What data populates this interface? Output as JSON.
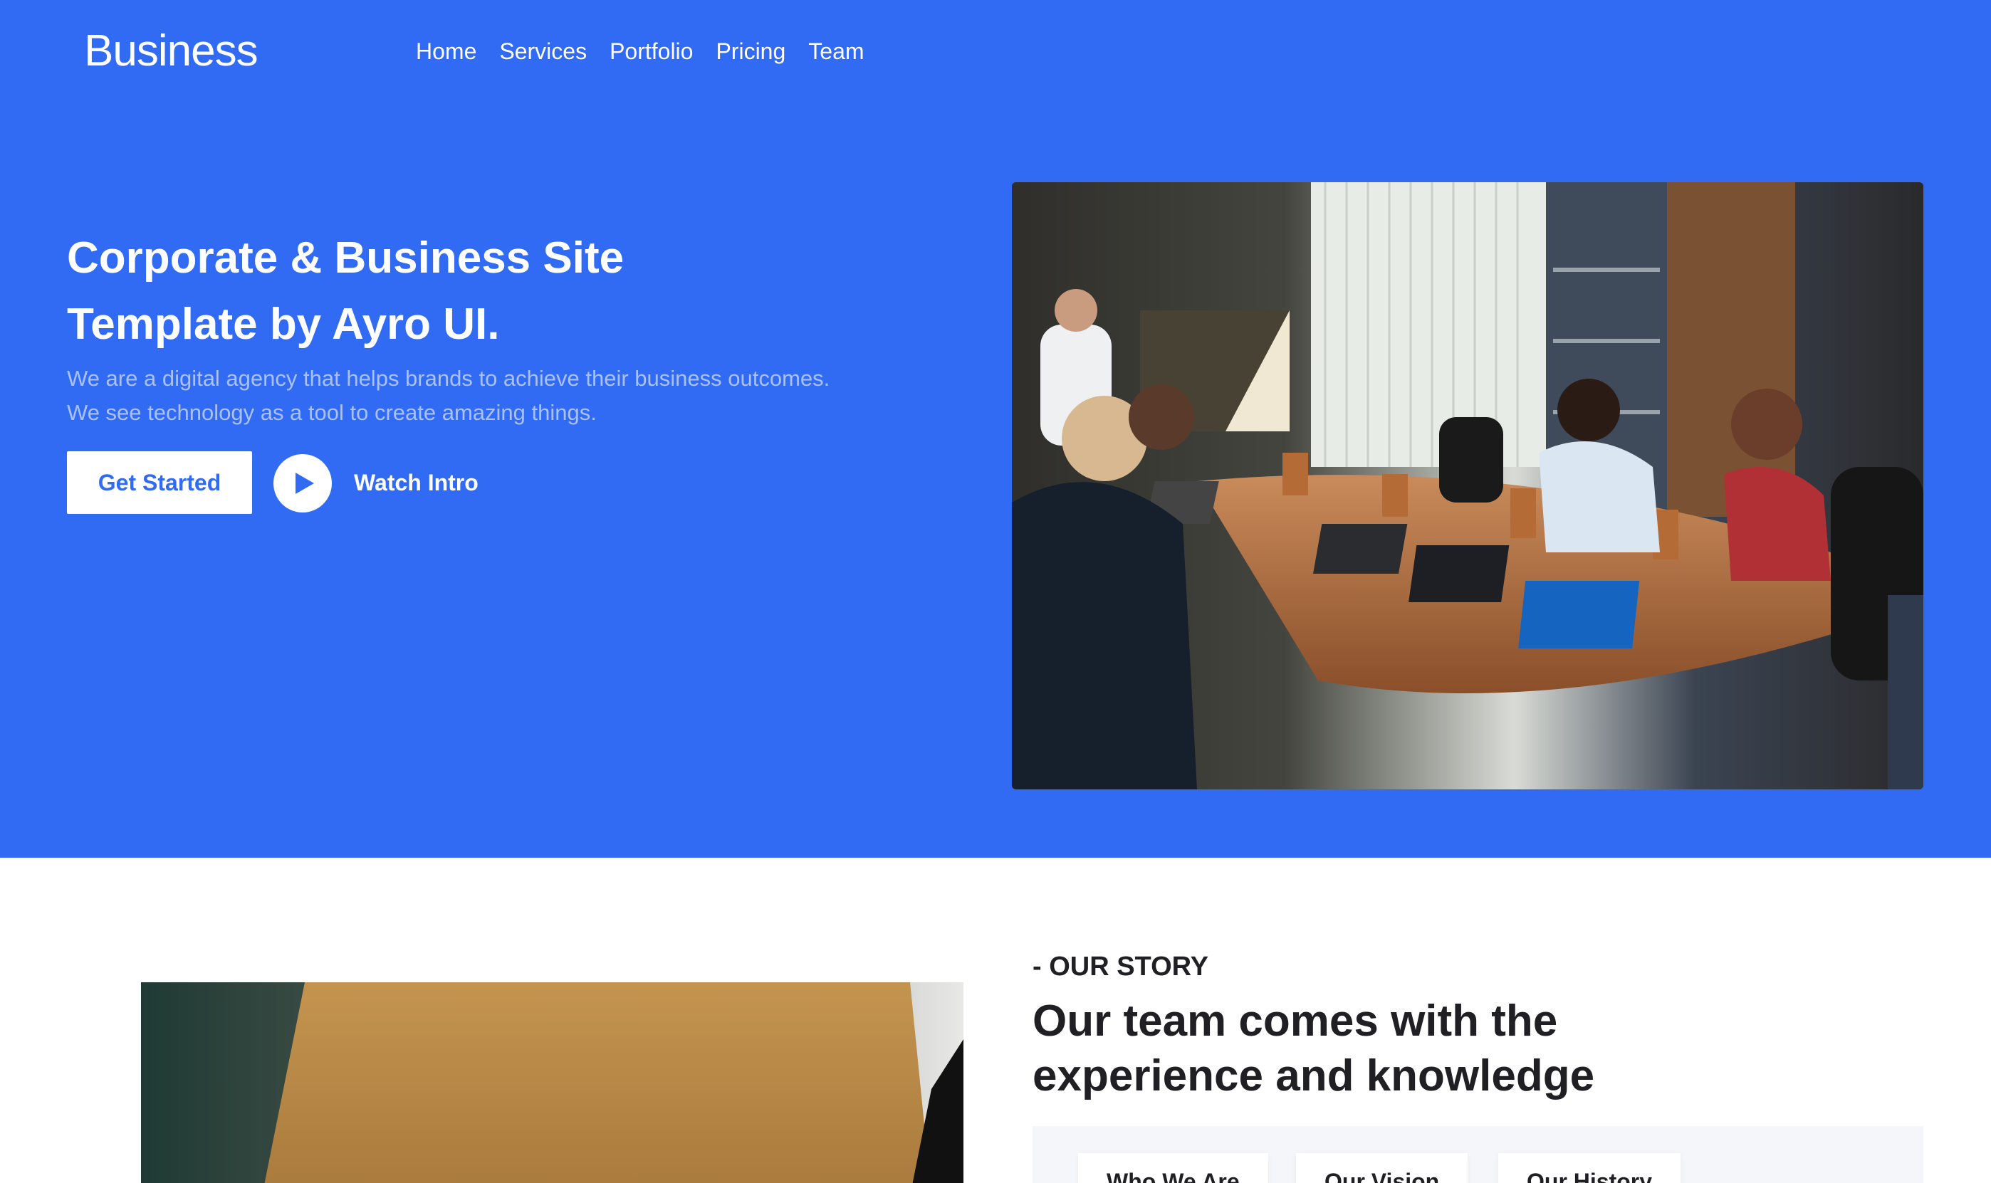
{
  "header": {
    "brand": "Business",
    "nav": [
      "Home",
      "Services",
      "Portfolio",
      "Pricing",
      "Team"
    ]
  },
  "hero": {
    "title_line1": "Corporate & Business Site",
    "title_line2": "Template by Ayro UI.",
    "desc_line1": "We are a digital agency that helps brands to achieve their business outcomes.",
    "desc_line2": "We see technology as a tool to create amazing things.",
    "cta_label": "Get Started",
    "watch_label": "Watch Intro"
  },
  "story": {
    "kicker": "- OUR STORY",
    "title_line1": "Our team comes with the",
    "title_line2": "experience and knowledge",
    "tabs": [
      "Who We Are",
      "Our Vision",
      "Our History"
    ]
  },
  "colors": {
    "primary": "#316BF4",
    "hero_desc": "#A9C1F8",
    "heading": "#1f1f24",
    "tab_panel": "#F4F6FA"
  },
  "icons": {
    "play": "play-icon"
  }
}
